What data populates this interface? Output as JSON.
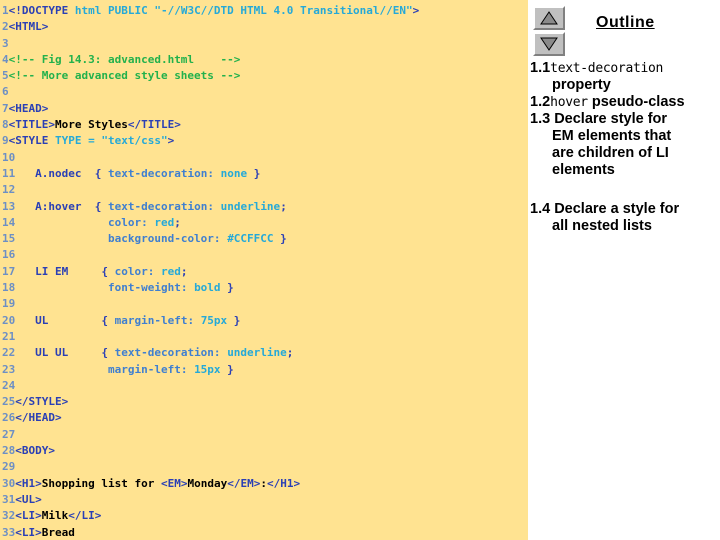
{
  "code_panel": {
    "background_color": "#ffe391",
    "lines": [
      {
        "n": "1",
        "segments": [
          {
            "t": "<!DOCTYPE",
            "c": "tag"
          },
          {
            "t": " html PUBLIC ",
            "c": "attr"
          },
          {
            "t": "\"-//W3C//DTD HTML 4.0 Transitional//EN\"",
            "c": "attr"
          },
          {
            "t": ">",
            "c": "tag"
          }
        ]
      },
      {
        "n": "2",
        "segments": [
          {
            "t": "<HTML>",
            "c": "tag"
          }
        ]
      },
      {
        "n": "3",
        "segments": []
      },
      {
        "n": "4",
        "segments": [
          {
            "t": "<!-- Fig 14.3: advanced.html    -->",
            "c": "comment"
          }
        ]
      },
      {
        "n": "5",
        "segments": [
          {
            "t": "<!-- More advanced style sheets -->",
            "c": "comment"
          }
        ]
      },
      {
        "n": "6",
        "segments": []
      },
      {
        "n": "7",
        "segments": [
          {
            "t": "<HEAD>",
            "c": "tag"
          }
        ]
      },
      {
        "n": "8",
        "segments": [
          {
            "t": "<TITLE>",
            "c": "tag"
          },
          {
            "t": "More Styles",
            "c": "plain"
          },
          {
            "t": "</TITLE>",
            "c": "tag"
          }
        ]
      },
      {
        "n": "9",
        "segments": [
          {
            "t": "<STYLE",
            "c": "tag"
          },
          {
            "t": " TYPE = ",
            "c": "attr"
          },
          {
            "t": "\"text/css\"",
            "c": "attr"
          },
          {
            "t": ">",
            "c": "tag"
          }
        ]
      },
      {
        "n": "10",
        "segments": []
      },
      {
        "n": "11",
        "segments": [
          {
            "t": "   A.nodec  ",
            "c": "tag"
          },
          {
            "t": "{ ",
            "c": "tag"
          },
          {
            "t": "text-decoration: ",
            "c": "prop"
          },
          {
            "t": "none",
            "c": "val"
          },
          {
            "t": " }",
            "c": "tag"
          }
        ]
      },
      {
        "n": "12",
        "segments": []
      },
      {
        "n": "13",
        "segments": [
          {
            "t": "   A:hover  ",
            "c": "tag"
          },
          {
            "t": "{ ",
            "c": "tag"
          },
          {
            "t": "text-decoration: ",
            "c": "prop"
          },
          {
            "t": "underline",
            "c": "val"
          },
          {
            "t": ";",
            "c": "tag"
          }
        ]
      },
      {
        "n": "14",
        "segments": [
          {
            "t": "              ",
            "c": "tag"
          },
          {
            "t": "color: ",
            "c": "prop"
          },
          {
            "t": "red",
            "c": "val"
          },
          {
            "t": ";",
            "c": "tag"
          }
        ]
      },
      {
        "n": "15",
        "segments": [
          {
            "t": "              ",
            "c": "tag"
          },
          {
            "t": "background-color: ",
            "c": "prop"
          },
          {
            "t": "#CCFFCC",
            "c": "val"
          },
          {
            "t": " }",
            "c": "tag"
          }
        ]
      },
      {
        "n": "16",
        "segments": []
      },
      {
        "n": "17",
        "segments": [
          {
            "t": "   LI EM     ",
            "c": "tag"
          },
          {
            "t": "{ ",
            "c": "tag"
          },
          {
            "t": "color: ",
            "c": "prop"
          },
          {
            "t": "red",
            "c": "val"
          },
          {
            "t": ";",
            "c": "tag"
          }
        ]
      },
      {
        "n": "18",
        "segments": [
          {
            "t": "              ",
            "c": "tag"
          },
          {
            "t": "font-weight: ",
            "c": "prop"
          },
          {
            "t": "bold",
            "c": "val"
          },
          {
            "t": " }",
            "c": "tag"
          }
        ]
      },
      {
        "n": "19",
        "segments": []
      },
      {
        "n": "20",
        "segments": [
          {
            "t": "   UL        ",
            "c": "tag"
          },
          {
            "t": "{ ",
            "c": "tag"
          },
          {
            "t": "margin-left: ",
            "c": "prop"
          },
          {
            "t": "75px",
            "c": "val"
          },
          {
            "t": " }",
            "c": "tag"
          }
        ]
      },
      {
        "n": "21",
        "segments": []
      },
      {
        "n": "22",
        "segments": [
          {
            "t": "   UL UL     ",
            "c": "tag"
          },
          {
            "t": "{ ",
            "c": "tag"
          },
          {
            "t": "text-decoration: ",
            "c": "prop"
          },
          {
            "t": "underline",
            "c": "val"
          },
          {
            "t": ";",
            "c": "tag"
          }
        ]
      },
      {
        "n": "23",
        "segments": [
          {
            "t": "              ",
            "c": "tag"
          },
          {
            "t": "margin-left: ",
            "c": "prop"
          },
          {
            "t": "15px",
            "c": "val"
          },
          {
            "t": " }",
            "c": "tag"
          }
        ]
      },
      {
        "n": "24",
        "segments": []
      },
      {
        "n": "25",
        "segments": [
          {
            "t": "</STYLE>",
            "c": "tag"
          }
        ]
      },
      {
        "n": "26",
        "segments": [
          {
            "t": "</HEAD>",
            "c": "tag"
          }
        ]
      },
      {
        "n": "27",
        "segments": []
      },
      {
        "n": "28",
        "segments": [
          {
            "t": "<BODY>",
            "c": "tag"
          }
        ]
      },
      {
        "n": "29",
        "segments": []
      },
      {
        "n": "30",
        "segments": [
          {
            "t": "<H1>",
            "c": "tag"
          },
          {
            "t": "Shopping list for ",
            "c": "plain"
          },
          {
            "t": "<EM>",
            "c": "tag"
          },
          {
            "t": "Monday",
            "c": "plain"
          },
          {
            "t": "</EM>",
            "c": "tag"
          },
          {
            "t": ":",
            "c": "plain"
          },
          {
            "t": "</H1>",
            "c": "tag"
          }
        ]
      },
      {
        "n": "31",
        "segments": [
          {
            "t": "<UL>",
            "c": "tag"
          }
        ]
      },
      {
        "n": "32",
        "segments": [
          {
            "t": "<LI>",
            "c": "tag"
          },
          {
            "t": "Milk",
            "c": "plain"
          },
          {
            "t": "</LI>",
            "c": "tag"
          }
        ]
      },
      {
        "n": "33",
        "segments": [
          {
            "t": "<LI>",
            "c": "tag"
          },
          {
            "t": "Bread",
            "c": "plain"
          }
        ]
      }
    ]
  },
  "outline": {
    "title": "Outline",
    "scroll_up_label": "scroll-up",
    "scroll_down_label": "scroll-down",
    "items": [
      {
        "num": "1.1",
        "parts": [
          {
            "t": "text-decoration",
            "f": "mono"
          }
        ],
        "continuation": "property"
      },
      {
        "num": "1.2",
        "parts": [
          {
            "t": "hover",
            "f": "mono"
          },
          {
            "t": " pseudo-class",
            "f": "sans"
          }
        ],
        "continuation": ""
      },
      {
        "num": "1.3",
        "parts": [
          {
            "t": " Declare style for",
            "f": "sans"
          }
        ],
        "continuation": "EM elements that\nare children of LI\nelements"
      },
      {
        "num": "1.4",
        "parts": [
          {
            "t": " Declare a style for",
            "f": "sans"
          }
        ],
        "continuation": "all nested lists",
        "gap_before": true
      }
    ]
  }
}
